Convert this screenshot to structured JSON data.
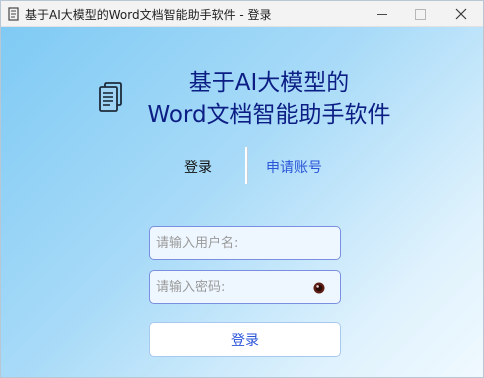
{
  "window": {
    "title": "基于AI大模型的Word文档智能助手软件 - 登录",
    "controls": {
      "minimize": "minimize",
      "maximize": "maximize",
      "close": "×"
    }
  },
  "header": {
    "logo_icon": "document-stack-icon",
    "title_line1": "基于AI大模型的",
    "title_line2": "Word文档智能助手软件"
  },
  "tabs": {
    "login": "登录",
    "register": "申请账号"
  },
  "form": {
    "username_placeholder": "请输入用户名:",
    "password_placeholder": "请输入密码:",
    "submit_label": "登录"
  },
  "colors": {
    "accent": "#2a55d9",
    "heading": "#0c1d84",
    "field_border": "#7b8fe0",
    "background_start": "#7fcaf4",
    "background_end": "#f0f9fe"
  }
}
